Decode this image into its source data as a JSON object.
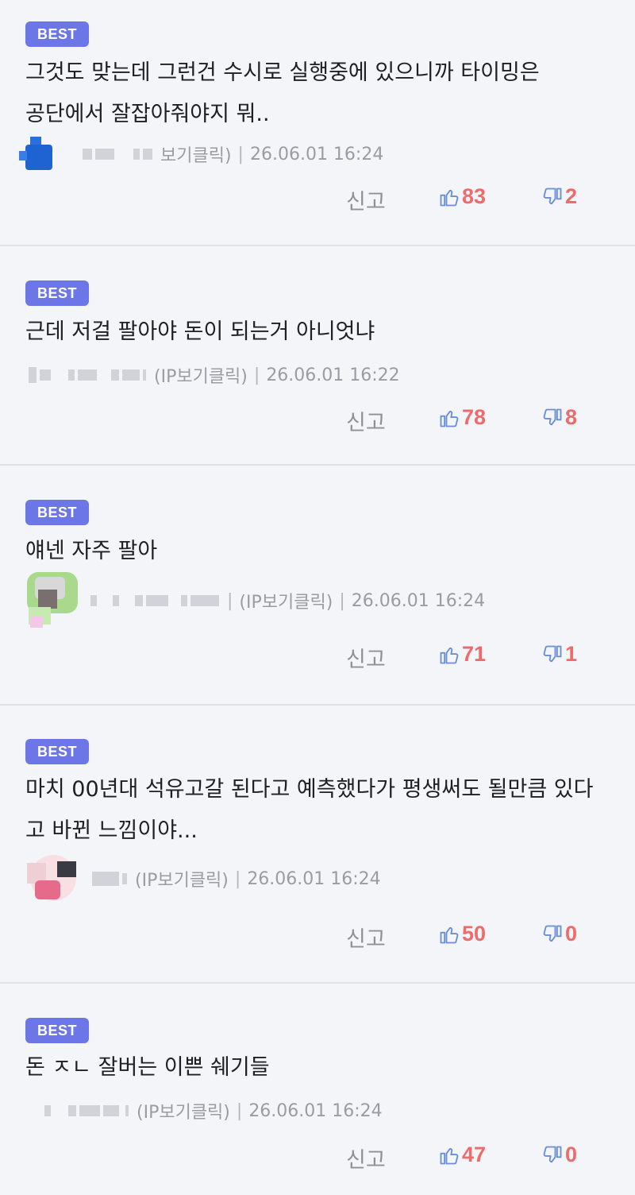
{
  "report_label": "신고",
  "comments": [
    {
      "badge": "BEST",
      "text": "그것도 맞는데 그런건 수시로 실행중에 있으니까 타이밍은 공단에서 잘잡아줘야지 뭐..",
      "ip_label": "보기클릭)",
      "date": "26.06.01 16:24",
      "likes": "83",
      "dislikes": "2"
    },
    {
      "badge": "BEST",
      "text": "근데 저걸 팔아야 돈이 되는거 아니엇냐",
      "ip_label": "(IP보기클릭)",
      "date": "26.06.01 16:22",
      "likes": "78",
      "dislikes": "8"
    },
    {
      "badge": "BEST",
      "text": "얘넨 자주 팔아",
      "ip_label": "(IP보기클릭)",
      "date": "26.06.01 16:24",
      "likes": "71",
      "dislikes": "1"
    },
    {
      "badge": "BEST",
      "text": "마치 00년대 석유고갈 된다고 예측했다가 평생써도 될만큼 있다고 바뀐 느낌이야...",
      "ip_label": "(IP보기클릭)",
      "date": "26.06.01 16:24",
      "likes": "50",
      "dislikes": "0"
    },
    {
      "badge": "BEST",
      "text": "돈 ㅈㄴ 잘버는 이쁜 쉐기들",
      "ip_label": "(IP보기클릭)",
      "date": "26.06.01 16:24",
      "likes": "47",
      "dislikes": "0"
    }
  ],
  "colors": {
    "badge": "#6c76e6",
    "count": "#ee6b6b",
    "thumb_icon": "#6a8fd8",
    "background": "#f4f5f9"
  },
  "icons": {
    "like": "thumbs-up-icon",
    "dislike": "thumbs-down-icon"
  }
}
